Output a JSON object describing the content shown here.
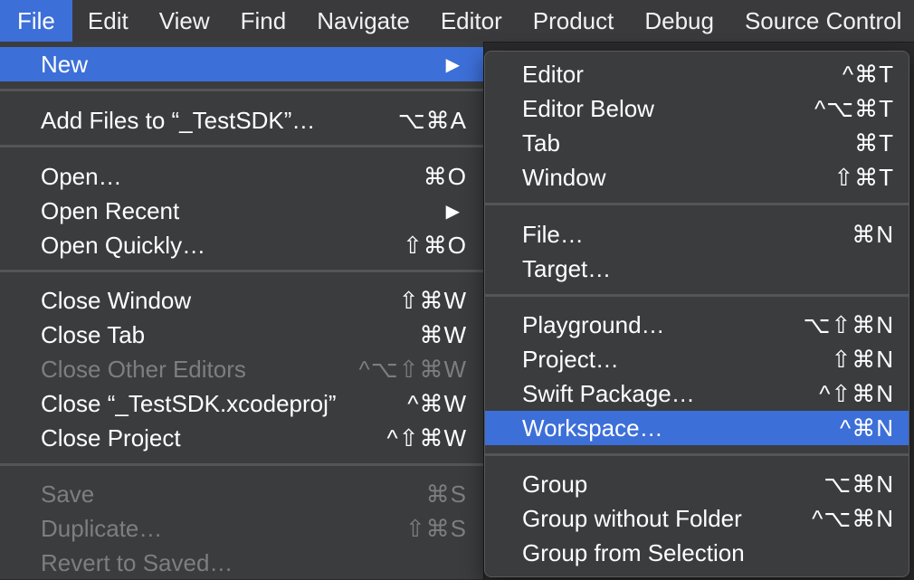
{
  "menubar": {
    "items": [
      "File",
      "Edit",
      "View",
      "Find",
      "Navigate",
      "Editor",
      "Product",
      "Debug",
      "Source Control"
    ]
  },
  "file_menu": {
    "items": [
      {
        "label": "New",
        "shortcut": "",
        "arrow": "▶"
      },
      {
        "label": "Add Files to “_TestSDK”…",
        "shortcut": "⌥⌘A"
      },
      {
        "label": "Open…",
        "shortcut": "⌘O"
      },
      {
        "label": "Open Recent",
        "shortcut": "",
        "arrow": "▶"
      },
      {
        "label": "Open Quickly…",
        "shortcut": "⇧⌘O"
      },
      {
        "label": "Close Window",
        "shortcut": "⇧⌘W"
      },
      {
        "label": "Close Tab",
        "shortcut": "⌘W"
      },
      {
        "label": "Close Other Editors",
        "shortcut": "^⌥⇧⌘W"
      },
      {
        "label": "Close “_TestSDK.xcodeproj”",
        "shortcut": "^⌘W"
      },
      {
        "label": "Close Project",
        "shortcut": "^⇧⌘W"
      },
      {
        "label": "Save",
        "shortcut": "⌘S"
      },
      {
        "label": "Duplicate…",
        "shortcut": "⇧⌘S"
      },
      {
        "label": "Revert to Saved…",
        "shortcut": ""
      }
    ]
  },
  "new_submenu": {
    "items": [
      {
        "label": "Editor",
        "shortcut": "^⌘T"
      },
      {
        "label": "Editor Below",
        "shortcut": "^⌥⌘T"
      },
      {
        "label": "Tab",
        "shortcut": "⌘T"
      },
      {
        "label": "Window",
        "shortcut": "⇧⌘T"
      },
      {
        "label": "File…",
        "shortcut": "⌘N"
      },
      {
        "label": "Target…",
        "shortcut": ""
      },
      {
        "label": "Playground…",
        "shortcut": "⌥⇧⌘N"
      },
      {
        "label": "Project…",
        "shortcut": "⇧⌘N"
      },
      {
        "label": "Swift Package…",
        "shortcut": "^⇧⌘N"
      },
      {
        "label": "Workspace…",
        "shortcut": "^⌘N"
      },
      {
        "label": "Group",
        "shortcut": "⌥⌘N"
      },
      {
        "label": "Group without Folder",
        "shortcut": "^⌥⌘N"
      },
      {
        "label": "Group from Selection",
        "shortcut": ""
      }
    ]
  },
  "colors": {
    "highlight": "#3d6fd8",
    "menu_bg": "#3b3c3e",
    "disabled_text": "#7d7e80"
  }
}
